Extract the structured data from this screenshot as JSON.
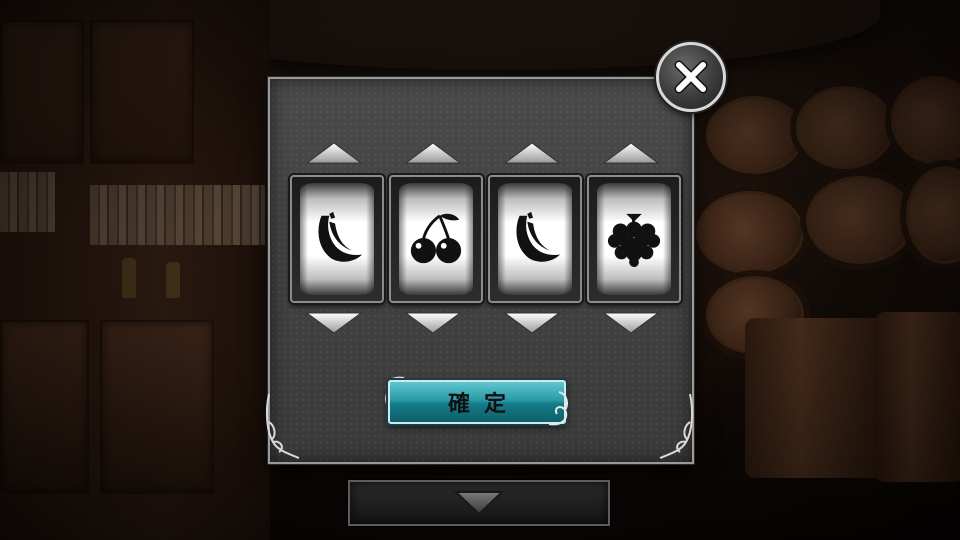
{
  "dialog": {
    "close_label": "X",
    "confirm_label": "確定"
  },
  "reels": [
    {
      "symbol": "banana-icon"
    },
    {
      "symbol": "cherry-icon"
    },
    {
      "symbol": "banana-icon"
    },
    {
      "symbol": "grape-icon"
    }
  ],
  "colors": {
    "confirm_button": "#1f8f9c",
    "panel": "#404040",
    "reel_face": "#ffffff",
    "symbol": "#111111"
  },
  "icons": {
    "close": "close-icon",
    "up_arrow": "triangle-up-icon",
    "down_arrow": "triangle-down-icon",
    "bottom_arrow": "triangle-down-icon"
  }
}
